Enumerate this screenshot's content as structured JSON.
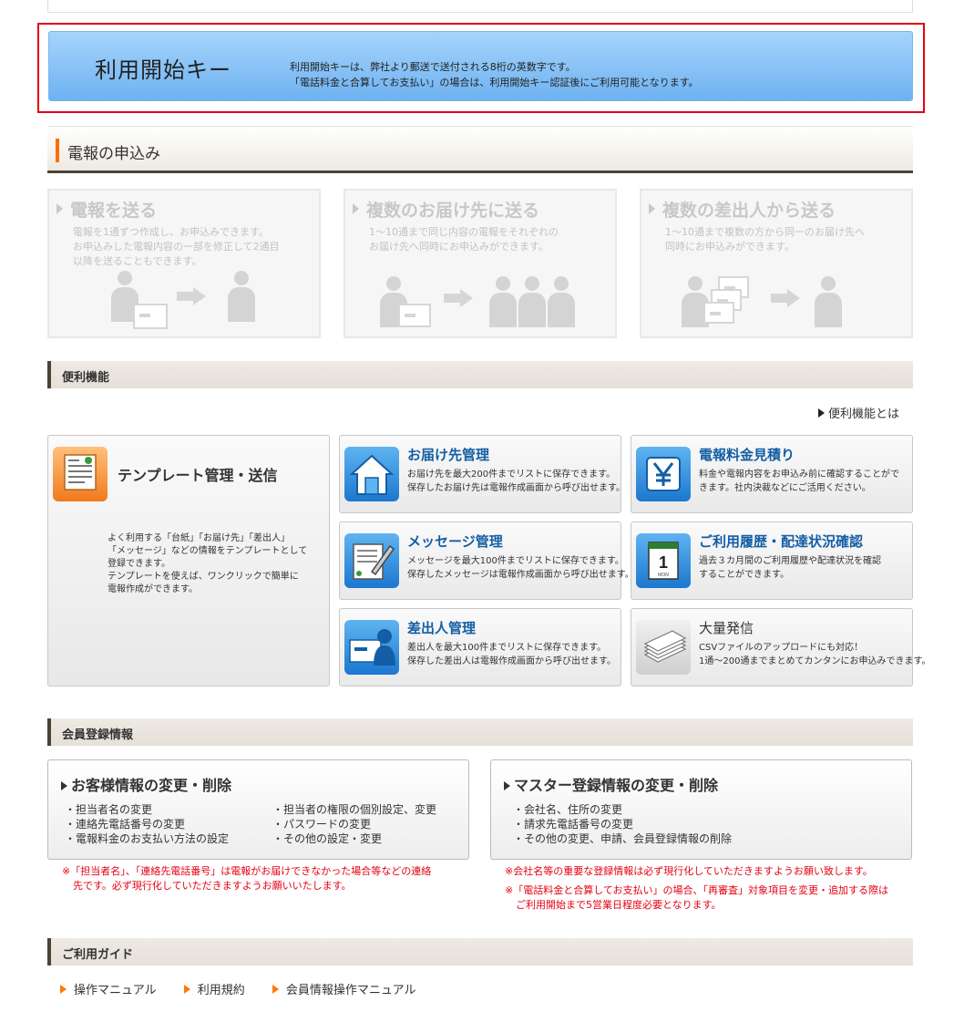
{
  "start_key": {
    "title": "利用開始キー",
    "desc_line1": "利用開始キーは、弊社より郵送で送付される8桁の英数字です。",
    "desc_line2": "「電話料金と合算してお支払い」の場合は、利用開始キー認証後にご利用可能となります。"
  },
  "application": {
    "header": "電報の申込み",
    "cards": [
      {
        "title": "電報を送る",
        "desc": [
          "電報を1通ずつ作成し、お申込みできます。",
          "お申込みした電報内容の一部を修正して2通目",
          "以降を送ることもできます。"
        ]
      },
      {
        "title": "複数のお届け先に送る",
        "desc": [
          "1～10通まで同じ内容の電報をそれぞれの",
          "お届け先へ同時にお申込みができます。"
        ]
      },
      {
        "title": "複数の差出人から送る",
        "desc": [
          "1～10通まで複数の方から同一のお届け先へ",
          "同時にお申込みができます。"
        ]
      }
    ]
  },
  "convenience": {
    "header": "便利機能",
    "about_link": "便利機能とは",
    "template": {
      "title": "テンプレート管理・送信",
      "desc": [
        "よく利用する「台紙」「お届け先」「差出人」",
        "「メッセージ」などの情報をテンプレートとして",
        "登録できます。",
        "テンプレートを使えば、ワンクリックで簡単に",
        "電報作成ができます。"
      ]
    },
    "features": [
      {
        "title": "お届け先管理",
        "desc": [
          "お届け先を最大200件までリストに保存できます。",
          "保存したお届け先は電報作成画面から呼び出せます。"
        ],
        "icon": "house-icon"
      },
      {
        "title": "電報料金見積り",
        "desc": [
          "料金や電報内容をお申込み前に確認することがで",
          "きます。社内決裁などにご活用ください。"
        ],
        "icon": "yen-icon"
      },
      {
        "title": "メッセージ管理",
        "desc": [
          "メッセージを最大100件までリストに保存できます。",
          "保存したメッセージは電報作成画面から呼び出せます。"
        ],
        "icon": "pen-document-icon"
      },
      {
        "title": "ご利用履歴・配達状況確認",
        "desc": [
          "過去３カ月間のご利用履歴や配達状況を確認",
          "することができます。"
        ],
        "icon": "calendar-icon",
        "calendar_day": "1",
        "calendar_month": "MON"
      },
      {
        "title": "差出人管理",
        "desc": [
          "差出人を最大100件までリストに保存できます。",
          "保存した差出人は電報作成画面から呼び出せます。"
        ],
        "icon": "sender-card-icon"
      },
      {
        "title": "大量発信",
        "desc": [
          "CSVファイルのアップロードにも対応！",
          "1通～200通までまとめてカンタンにお申込みできます。"
        ],
        "icon": "paper-stack-icon"
      }
    ]
  },
  "member": {
    "header": "会員登録情報",
    "customer": {
      "title": "お客様情報の変更・削除",
      "col1": [
        "・担当者名の変更",
        "・連絡先電話番号の変更",
        "・電報料金のお支払い方法の設定"
      ],
      "col2": [
        "・担当者の権限の個別設定、変更",
        "・パスワードの変更",
        "・その他の設定・変更"
      ],
      "note": [
        "※「担当者名」、「連絡先電話番号」は電報がお届けできなかった場合等などの連絡",
        "先です。必ず現行化していただきますようお願いいたします。"
      ]
    },
    "master": {
      "title": "マスター登録情報の変更・削除",
      "items": [
        "・会社名、住所の変更",
        "・請求先電話番号の変更",
        "・その他の変更、申請、会員登録情報の削除"
      ],
      "note1": "※会社名等の重要な登録情報は必ず現行化していただきますようお願い致します。",
      "note2": [
        "※「電話料金と合算してお支払い」の場合、「再審査」対象項目を変更・追加する際は",
        "ご利用開始まで5営業日程度必要となります。"
      ]
    }
  },
  "guide": {
    "header": "ご利用ガイド",
    "links": [
      "操作マニュアル",
      "利用規約",
      "会員情報操作マニュアル"
    ]
  },
  "colors": {
    "accent_orange": "#ff6c00",
    "banner_blue": "#7bbaf2",
    "warning_red": "#e60012",
    "feature_title_blue": "#135ea5"
  }
}
